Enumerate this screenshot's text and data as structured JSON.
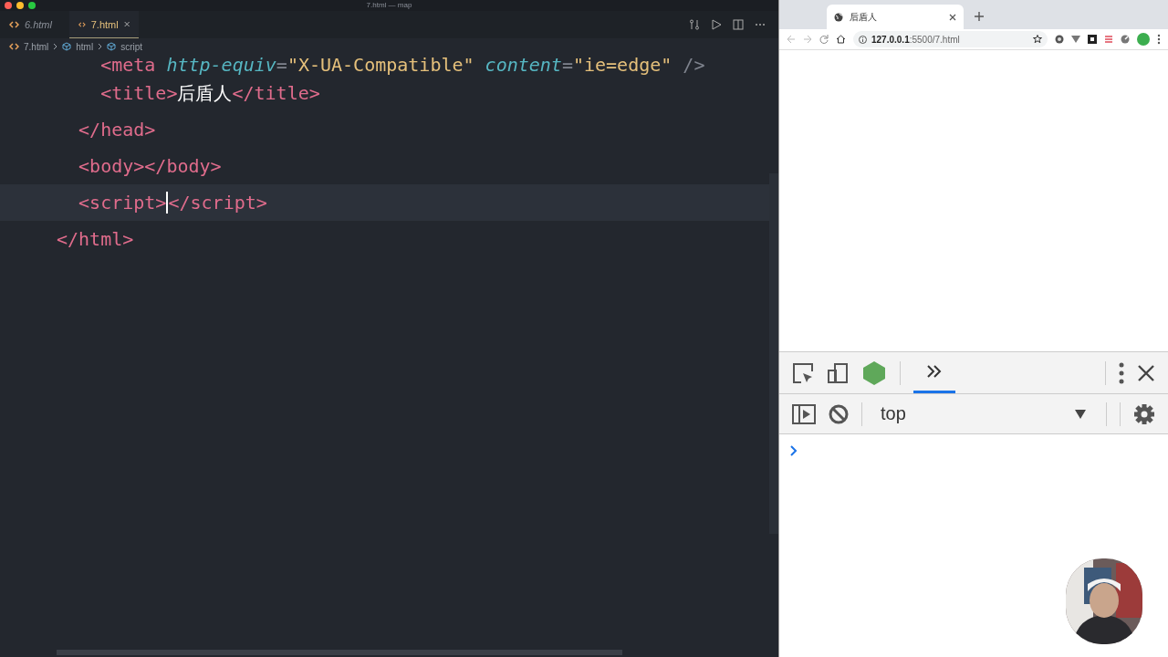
{
  "editor": {
    "window_title": "7.html — map",
    "tabs": [
      {
        "label": "6.html",
        "selected": false,
        "preview": true
      },
      {
        "label": "7.html",
        "selected": true,
        "preview": false
      }
    ],
    "breadcrumb": [
      "7.html",
      "html",
      "script"
    ],
    "lines": [
      {
        "current": false,
        "tokens": [
          {
            "kind": "tag",
            "text": "    <meta"
          },
          {
            "kind": "attr",
            "text": " http-equiv"
          },
          {
            "kind": "punct",
            "text": "="
          },
          {
            "kind": "string",
            "text": "\"X-UA-Compatible\""
          },
          {
            "kind": "attr",
            "text": " content"
          },
          {
            "kind": "punct",
            "text": "="
          },
          {
            "kind": "string",
            "text": "\"ie=edge\""
          },
          {
            "kind": "punct",
            "text": " />"
          }
        ]
      },
      {
        "current": false,
        "tokens": [
          {
            "kind": "tag",
            "text": "    <title>"
          },
          {
            "kind": "text",
            "text": "后盾人"
          },
          {
            "kind": "tag",
            "text": "</title>"
          }
        ]
      },
      {
        "current": false,
        "tokens": [
          {
            "kind": "tag",
            "text": "  </head>"
          }
        ]
      },
      {
        "current": false,
        "tokens": [
          {
            "kind": "tag",
            "text": "  <body></body>"
          }
        ]
      },
      {
        "current": true,
        "tokens": [
          {
            "kind": "tag",
            "text": "  <script>"
          },
          {
            "kind": "tag",
            "text": "</script>",
            "cursor": true
          }
        ]
      },
      {
        "current": false,
        "tokens": [
          {
            "kind": "tag",
            "text": "</html>"
          }
        ]
      }
    ]
  },
  "browser": {
    "tab_title": "后盾人",
    "url": "**127.0.0.1**:5500/7.html",
    "devtools": {
      "more_tabs_selected": true,
      "context": "top"
    }
  }
}
